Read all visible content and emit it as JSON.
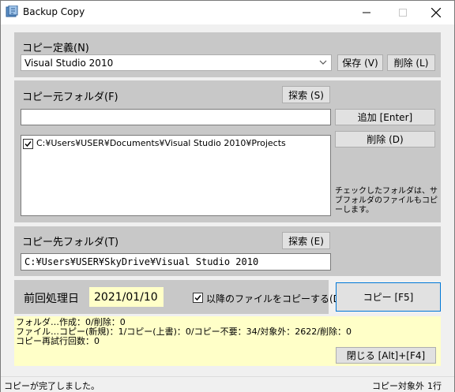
{
  "window": {
    "title": "Backup Copy",
    "minimize_icon": "minimize-icon",
    "maximize_icon": "maximize-icon",
    "close_icon": "close-icon"
  },
  "copy_definition": {
    "label": "コピー定義(N)",
    "selected": "Visual Studio 2010",
    "save_button": "保存 (V)",
    "delete_button": "削除 (L)"
  },
  "source": {
    "label": "コピー元フォルダ(F)",
    "search_button": "探索 (S)",
    "input_value": "",
    "add_button": "追加 [Enter]",
    "delete_button": "削除 (D)",
    "items": [
      {
        "checked": true,
        "path": "C:¥Users¥USER¥Documents¥Visual Studio 2010¥Projects"
      }
    ],
    "note": "チェックしたフォルダは、サブフォルダのファイルもコピーします。"
  },
  "destination": {
    "label": "コピー先フォルダ(T)",
    "search_button": "探索 (E)",
    "path": "C:¥Users¥USER¥SkyDrive¥Visual Studio 2010"
  },
  "last_run": {
    "label": "前回処理日",
    "date": "2021/01/10",
    "only_after_checkbox_label": "以降のファイルをコピーする(D)",
    "only_after_checked": true,
    "copy_button": "コピー [F5]"
  },
  "result": {
    "lines": [
      "フォルダ…作成：0/削除：0",
      "ファイル…コピー(新規)：1/コピー(上書)：0/コピー不要：34/対象外：2622/削除：0",
      "コピー再試行回数：0"
    ],
    "close_button": "閉じる [Alt]+[F4]"
  },
  "status": {
    "message": "コピーが完了しました。",
    "right_text": "コピー対象外",
    "line_count": "1行"
  },
  "colors": {
    "panel": "#c8c8c8",
    "highlight": "#ffffc8",
    "background": "#f0f0f0"
  }
}
